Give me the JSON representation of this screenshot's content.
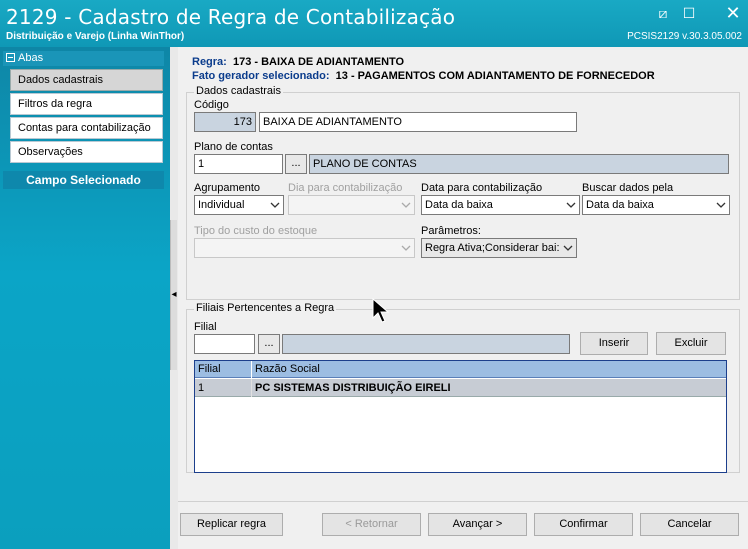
{
  "window": {
    "title": "2129 - Cadastro de Regra de Contabilização",
    "subtitle": "Distribuição e Varejo (Linha WinThor)",
    "version": "PCSIS2129  v.30.3.05.002",
    "controls": {
      "minimize": "⧄",
      "maximize": "☐",
      "close": "✕"
    }
  },
  "sidebar": {
    "header": "Abas",
    "items": [
      {
        "label": "Dados cadastrais",
        "active": true
      },
      {
        "label": "Filtros da regra"
      },
      {
        "label": "Contas para contabilização"
      },
      {
        "label": "Observações"
      }
    ],
    "selected_title": "Campo Selecionado",
    "collapse_glyph": "◂"
  },
  "info": {
    "rule_label": "Regra:",
    "rule_value": "173 - BAIXA DE ADIANTAMENTO",
    "trigger_label": "Fato gerador selecionado:",
    "trigger_value": "13 - PAGAMENTOS COM ADIANTAMENTO DE FORNECEDOR"
  },
  "dados": {
    "group_title": "Dados cadastrais",
    "codigo_label": "Código",
    "codigo_value": "173",
    "descricao_value": "BAIXA DE ADIANTAMENTO",
    "plano_label": "Plano de contas",
    "plano_code": "1",
    "plano_lookup": "...",
    "plano_desc": "PLANO DE CONTAS",
    "agrupamento_label": "Agrupamento",
    "agrupamento_value": "Individual",
    "dia_label": "Dia para contabilização",
    "dia_value": "",
    "data_label": "Data para contabilização",
    "data_value": "Data da baixa",
    "buscar_label": "Buscar dados pela",
    "buscar_value": "Data da baixa",
    "tipo_label": "Tipo do custo do estoque",
    "tipo_value": "",
    "parametros_label": "Parâmetros:",
    "parametros_value": "Regra Ativa;Considerar bai:"
  },
  "filiais": {
    "group_title": "Filiais Pertencentes a Regra",
    "filial_label": "Filial",
    "filial_value": "",
    "lookup": "...",
    "filial_desc": "",
    "inserir": "Inserir",
    "excluir": "Excluir",
    "columns": [
      "Filial",
      "Razão Social"
    ],
    "rows": [
      {
        "filial": "1",
        "razao": "PC SISTEMAS DISTRIBUIÇÃO  EIRELI"
      }
    ]
  },
  "footer": {
    "replicar": "Replicar regra",
    "retornar": "< Retornar",
    "avancar": "Avançar >",
    "confirmar": "Confirmar",
    "cancelar": "Cancelar"
  },
  "colors": {
    "titlebar": "#13a0bd",
    "sidebar": "#0ba5c7",
    "accent_label": "#0b3c8c",
    "grid_header": "#9cbde2",
    "grid_row": "#c7ccd4"
  }
}
